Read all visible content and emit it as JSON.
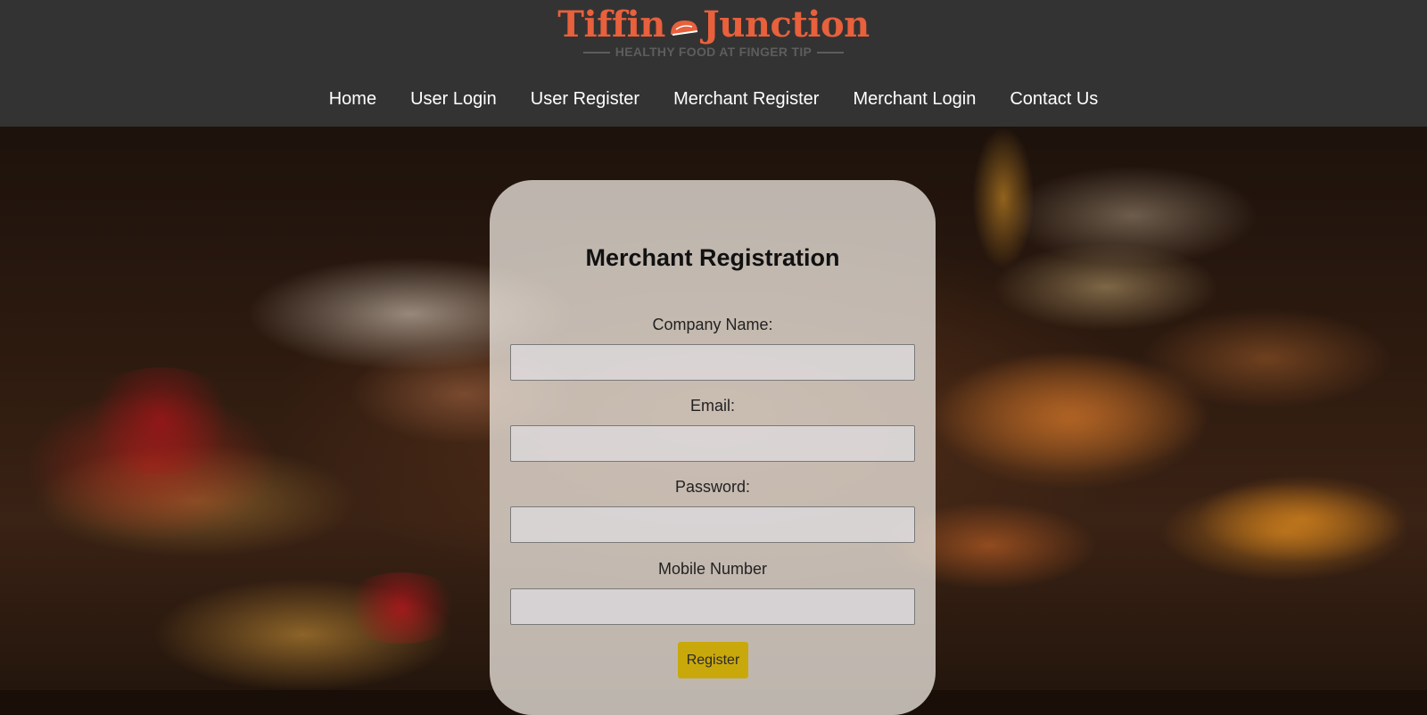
{
  "brand": {
    "name_part1": "Tiffin",
    "name_part2": "Junction",
    "tagline": "HEALTHY FOOD AT FINGER TIP",
    "color": "#e8603c"
  },
  "nav": {
    "items": [
      {
        "label": "Home"
      },
      {
        "label": "User Login"
      },
      {
        "label": "User Register"
      },
      {
        "label": "Merchant Register"
      },
      {
        "label": "Merchant Login"
      },
      {
        "label": "Contact Us"
      }
    ]
  },
  "form": {
    "title": "Merchant Registration",
    "company_label": "Company Name:",
    "company_value": "",
    "email_label": "Email:",
    "email_value": "",
    "password_label": "Password:",
    "password_value": "",
    "mobile_label": "Mobile Number",
    "mobile_value": "",
    "submit_label": "Register",
    "submit_color": "#c9a80c"
  },
  "header_color": "#333333",
  "background_image": "food-spread-icon"
}
